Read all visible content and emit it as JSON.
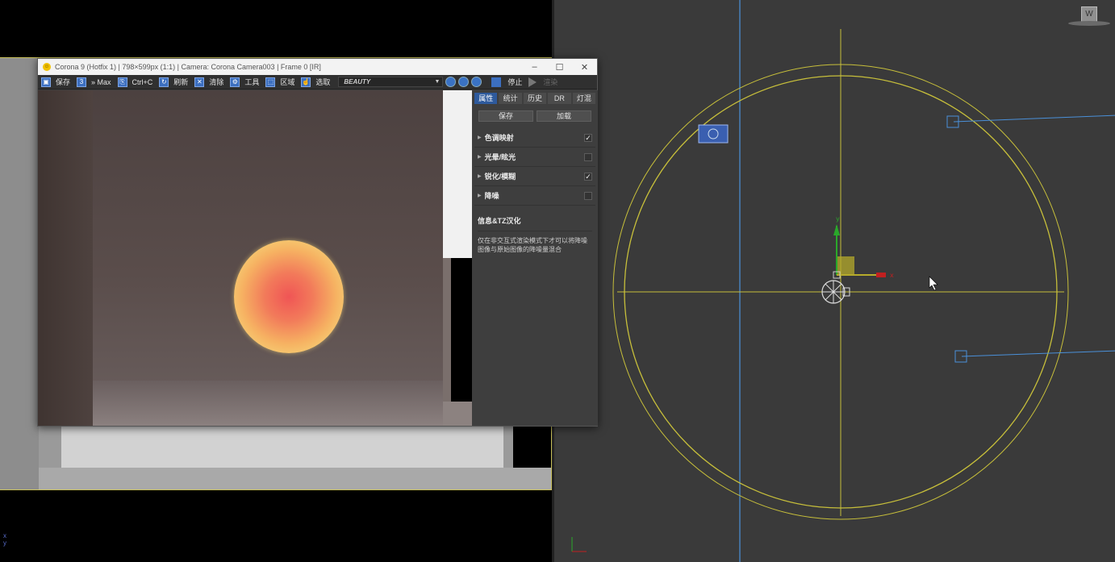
{
  "vfb": {
    "title": "Corona 9 (Hotfix 1) | 798×599px (1:1) | Camera: Corona Camera003 | Frame 0 [IR]",
    "window_buttons": [
      "–",
      "☐",
      "✕"
    ],
    "toolbar": {
      "save": "保存",
      "max": "» Max",
      "copy": "Ctrl+C",
      "refresh": "刷新",
      "clear": "清除",
      "tools": "工具",
      "region": "区域",
      "pick": "选取",
      "pass": "BEAUTY",
      "stop": "停止",
      "render": "渲染"
    },
    "tabs": [
      "属性",
      "统计",
      "历史",
      "DR",
      "灯混"
    ],
    "active_tab": "属性",
    "save_btn": "保存",
    "load_btn": "加载",
    "sections": [
      {
        "label": "色调映射",
        "checked": true
      },
      {
        "label": "光晕/眩光",
        "checked": false
      },
      {
        "label": "锐化/模糊",
        "checked": true
      },
      {
        "label": "降噪",
        "checked": false
      }
    ],
    "info_title": "信息&TZ汉化",
    "info_text": "仅在非交互式渲染模式下才可以将降噪图像与原始图像的降噪量混合"
  },
  "left_viewport": {
    "axis_x": "x",
    "axis_y": "y"
  },
  "right_viewport": {
    "corner_icon": "W",
    "axis_label_y": "y",
    "axis_label_x": "x"
  },
  "colors": {
    "accent_blue": "#3c6fc0",
    "wire_yellow": "#c7bf3a",
    "grid_blue": "#4a90d9",
    "viewport_bg": "#3a3a3a"
  }
}
